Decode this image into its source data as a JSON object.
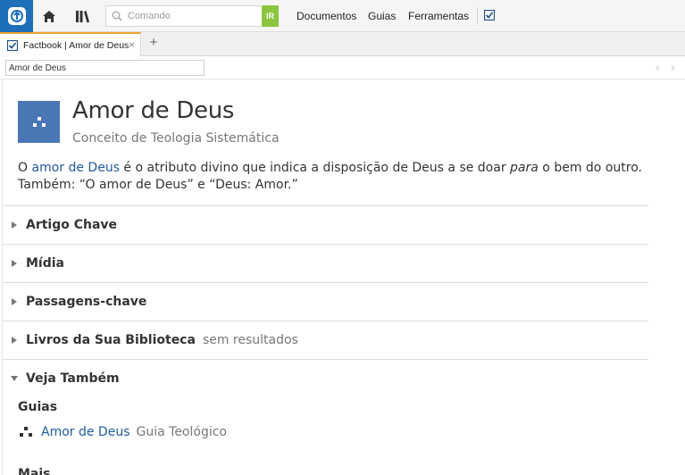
{
  "toolbar": {
    "logo_icon": "logos-logo-icon",
    "home_icon": "home-icon",
    "library_icon": "library-icon",
    "search": {
      "placeholder": "Comando",
      "value": "",
      "go_label": "IR"
    },
    "menu": [
      "Documentos",
      "Guias",
      "Ferramentas"
    ],
    "checklist_icon": "checklist-icon"
  },
  "tab": {
    "label": "Factbook | Amor de Deus",
    "close": "×",
    "add": "+"
  },
  "address": {
    "value": "Amor de Deus",
    "back": "‹",
    "forward": "›"
  },
  "article": {
    "title": "Amor de Deus",
    "subtitle": "Conceito de Teologia Sistemática",
    "desc_pre": "O ",
    "desc_link": "amor de Deus",
    "desc_mid": " é o atributo divino que indica a disposição de Deus a se doar ",
    "desc_em": "para",
    "desc_post": " o bem do outro.",
    "desc_line2": "Também: “O amor de Deus” e “Deus: Amor.”"
  },
  "sections": [
    {
      "label": "Artigo Chave",
      "note": ""
    },
    {
      "label": "Mídia",
      "note": ""
    },
    {
      "label": "Passagens-chave",
      "note": ""
    },
    {
      "label": "Livros da Sua Biblioteca",
      "note": "sem resultados"
    },
    {
      "label": "Veja Também",
      "note": ""
    }
  ],
  "see_also": {
    "group_label": "Guias",
    "items": [
      {
        "text": "Amor de Deus",
        "type": "Guia Teológico"
      }
    ],
    "next_group_label": "Mais"
  },
  "colors": {
    "accent_blue": "#1f6fb8",
    "link": "#1f5a9e",
    "go_green": "#8cc63f",
    "tab_orange": "#f0a030",
    "title_icon_bg": "#4a76b5"
  }
}
